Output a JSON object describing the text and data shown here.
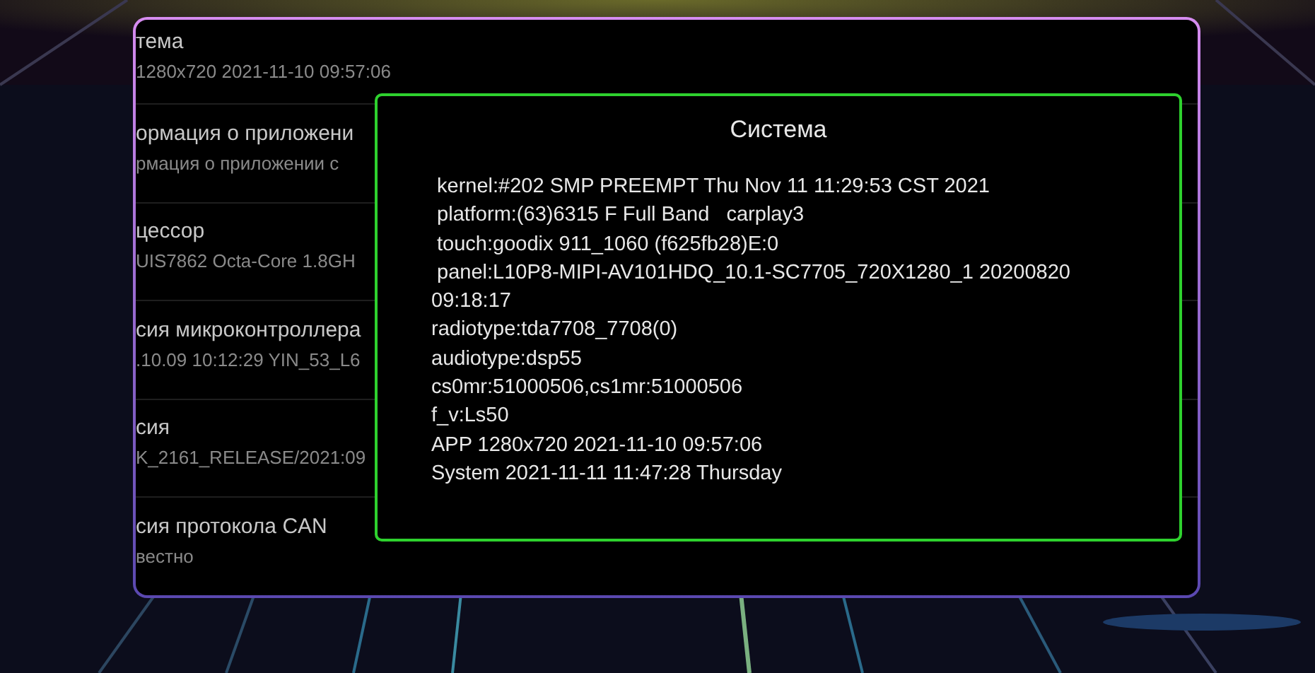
{
  "settings_list": [
    {
      "title": "тема",
      "subtitle": "1280x720 2021-11-10 09:57:06"
    },
    {
      "title": "ормация о приложени",
      "subtitle": "рмация о приложении с"
    },
    {
      "title": "цессор",
      "subtitle": "UIS7862 Octa-Core 1.8GH"
    },
    {
      "title": "сия микроконтроллера",
      "subtitle": ".10.09 10:12:29 YIN_53_L6"
    },
    {
      "title": "сия",
      "subtitle": "K_2161_RELEASE/2021:09"
    },
    {
      "title": "сия протокола CAN",
      "subtitle": "вестно"
    }
  ],
  "dialog": {
    "title": "Система",
    "lines": [
      " kernel:#202 SMP PREEMPT Thu Nov 11 11:29:53 CST 2021",
      " platform:(63)6315 F Full Band   carplay3",
      " touch:goodix 911_1060 (f625fb28)E:0",
      " panel:L10P8-MIPI-AV101HDQ_10.1-SC7705_720X1280_1 20200820",
      "09:18:17",
      "radiotype:tda7708_7708(0)",
      "audiotype:dsp55",
      "cs0mr:51000506,cs1mr:51000506",
      "f_v:Ls50",
      "APP 1280x720 2021-11-10 09:57:06",
      "System 2021-11-11 11:47:28 Thursday"
    ]
  }
}
